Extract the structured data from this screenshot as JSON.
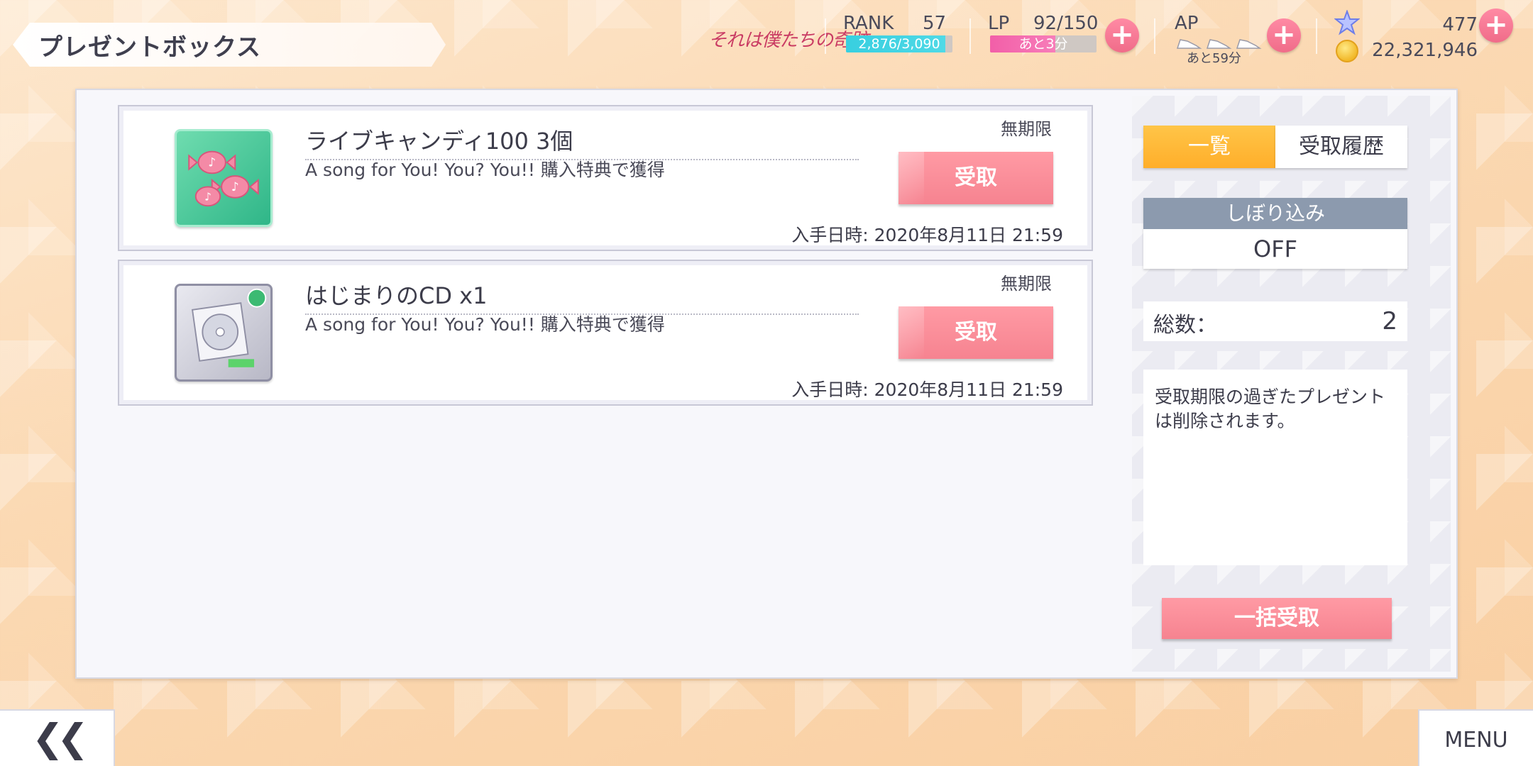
{
  "header": {
    "title": "プレゼントボックス",
    "song_logo": "それは僕たちの奇跡",
    "rank": {
      "label": "RANK",
      "value": "57",
      "exp": "2,876/3,090",
      "progress": 0.93
    },
    "lp": {
      "label": "LP",
      "value": "92/150",
      "recover": "あと3分",
      "progress": 0.61
    },
    "ap": {
      "label": "AP",
      "recover": "あと59分",
      "icons": "shoe-icon"
    },
    "stars": "477",
    "gold": "22,321,946"
  },
  "gifts": [
    {
      "name": "ライブキャンディ100 3個",
      "description": "A song for You! You? You!! 購入特典で獲得",
      "expiry": "無期限",
      "received_at": "入手日時: 2020年8月11日 21:59",
      "button": "受取",
      "icon": "candy-icon"
    },
    {
      "name": "はじまりのCD x1",
      "description": "A song for You! You? You!! 購入特典で獲得",
      "expiry": "無期限",
      "received_at": "入手日時: 2020年8月11日 21:59",
      "button": "受取",
      "icon": "cd-icon"
    }
  ],
  "sidebar": {
    "tabs": [
      "一覧",
      "受取履歴"
    ],
    "active_tab": "一覧",
    "filter": {
      "label": "しぼり込み",
      "value": "OFF"
    },
    "total": {
      "label": "総数：",
      "value": "2"
    },
    "note": "受取期限の過ぎたプレゼントは削除されます。",
    "bulk_button": "一括受取"
  },
  "footer": {
    "back": "❮❮",
    "menu": "MENU"
  },
  "colors": {
    "accent_pink": "#f68390",
    "tab_active": "#ffae2a",
    "rank_bar": "#38cfe0",
    "lp_bar": "#f25fa8",
    "filter_head": "#8c9aae"
  }
}
